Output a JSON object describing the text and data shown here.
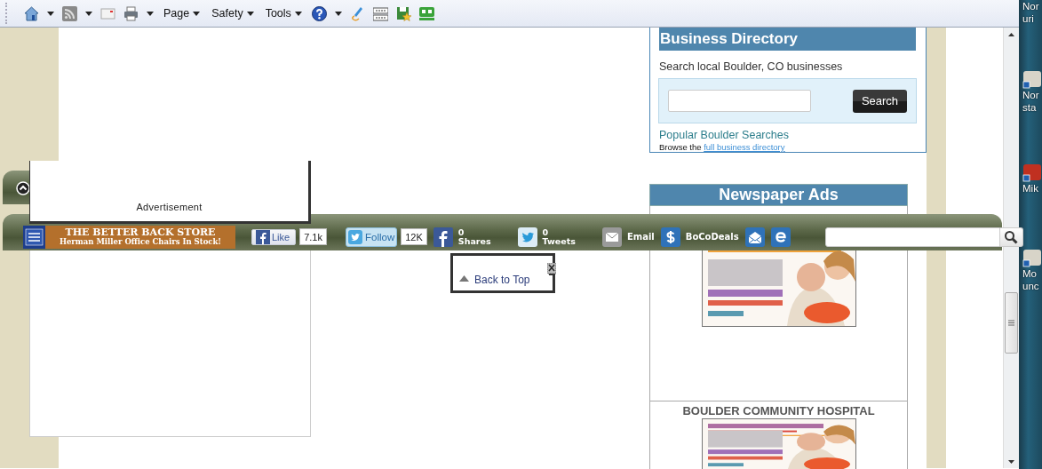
{
  "command_bar": {
    "menus": [
      {
        "label": "Page"
      },
      {
        "label": "Safety"
      },
      {
        "label": "Tools"
      }
    ]
  },
  "business_directory": {
    "title": "Business Directory",
    "prompt": "Search local Boulder, CO businesses",
    "search_button": "Search",
    "popular_link": "Popular Boulder Searches",
    "browse_text": "Browse the",
    "browse_link": "full business directory"
  },
  "newspaper_ads": {
    "title": "Newspaper Ads",
    "sections": [
      {
        "image": {
          "kind": "picture"
        }
      },
      {
        "heading": "BOULDER COMMUNITY HOSPITAL",
        "image": {
          "kind": "picture"
        }
      }
    ]
  },
  "advertisement": {
    "label": "Advertisement"
  },
  "share_bar": {
    "banner": {
      "title": "THE BETTER BACK STORE",
      "subtitle": "Herman Miller Office Chairs In Stock!"
    },
    "like": {
      "label": "Like",
      "count": "7.1k"
    },
    "follow": {
      "label": "Follow",
      "count": "12K"
    },
    "items": [
      {
        "kind": "facebook",
        "count": "0",
        "label": "Shares"
      },
      {
        "kind": "twitter",
        "count": "0",
        "label": "Tweets"
      },
      {
        "kind": "email",
        "label": "Email"
      },
      {
        "kind": "deals",
        "label": "BoCoDeals"
      },
      {
        "kind": "newsletter"
      },
      {
        "kind": "edition"
      }
    ]
  },
  "back_to_top": {
    "label": "Back to Top"
  },
  "desktop": {
    "icons": [
      {
        "lines": [
          "Nor",
          "uri"
        ]
      },
      {
        "lines": [
          "Nor",
          "sta"
        ]
      },
      {
        "lines": [
          "Mik"
        ]
      },
      {
        "lines": [
          "Mo",
          "unc"
        ]
      }
    ]
  }
}
